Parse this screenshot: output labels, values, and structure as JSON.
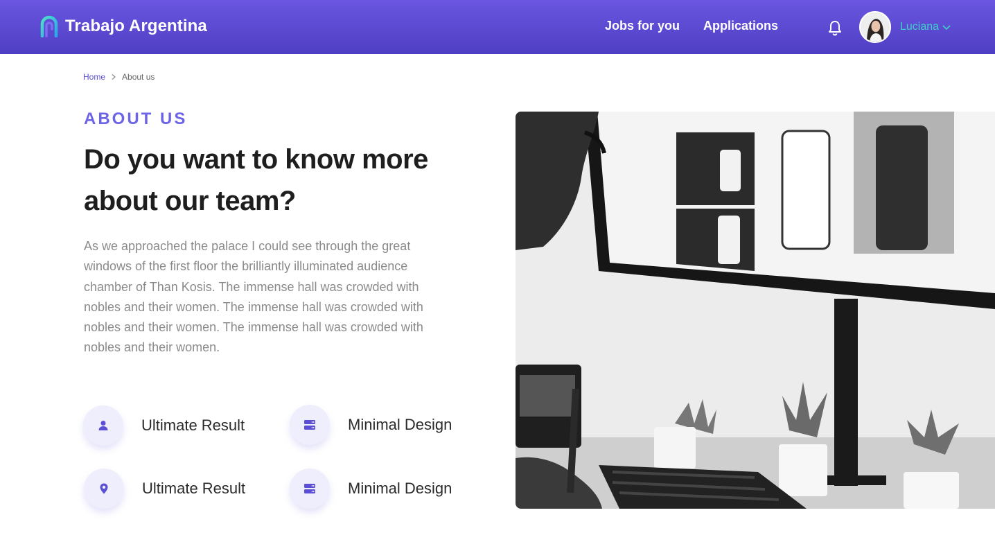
{
  "header": {
    "brand": "Trabajo Argentina",
    "nav": [
      {
        "label": "Jobs for you"
      },
      {
        "label": "Applications"
      }
    ],
    "user": {
      "name": "Luciana"
    },
    "colors": {
      "gradient_top": "#6a56e0",
      "gradient_bottom": "#4f3fc4",
      "user_accent": "#3fd0c6"
    }
  },
  "breadcrumb": {
    "items": [
      {
        "label": "Home"
      },
      {
        "label": "About us"
      }
    ]
  },
  "about": {
    "eyebrow": "ABOUT US",
    "headline": "Do you want to know more about our team?",
    "body": "As we approached the palace I could see through the great windows of the first floor the brilliantly illuminated audience chamber of Than Kosis. The immense hall was crowded with nobles and their women. The immense hall was crowded with nobles and their women. The immense hall was crowded with nobles and their women."
  },
  "features": [
    {
      "label": "Ultimate Result",
      "icon": "person-icon"
    },
    {
      "label": "Minimal Design",
      "icon": "server-icon"
    },
    {
      "label": "Ultimate Result",
      "icon": "location-pin-icon"
    },
    {
      "label": "Minimal Design",
      "icon": "server-icon"
    }
  ],
  "accent_color": "#6d63e6"
}
